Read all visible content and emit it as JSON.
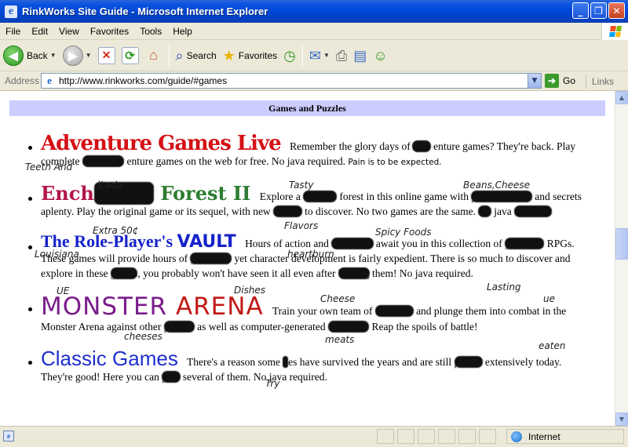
{
  "window": {
    "title": "RinkWorks Site Guide - Microsoft Internet Explorer",
    "buttons": {
      "minimize": "_",
      "maximize": "❐",
      "close": "✕"
    }
  },
  "menu": [
    "File",
    "Edit",
    "View",
    "Favorites",
    "Tools",
    "Help"
  ],
  "toolbar": {
    "back": "Back",
    "search": "Search",
    "favorites": "Favorites"
  },
  "address": {
    "label": "Address",
    "url": "http://www.rinkworks.com/guide/#games",
    "go": "Go",
    "links": "Links"
  },
  "page": {
    "section_title": "Games and Puzzles",
    "games": [
      {
        "logo": "Adventure Games Live",
        "text_a": "Remember the glory days of",
        "text_b": "enture games? They're back. Play complete",
        "text_c": "enture games on the web for free. No java required.",
        "note": "Pain is to be expected.",
        "scrawls": [
          "Teeth And"
        ]
      },
      {
        "logo_a": "Ench",
        "logo_b": "Forest II",
        "text_a": "Explore a",
        "text_b": "forest in this online game with",
        "text_c": "and secrets aplenty. Play the original game or its sequel, with new",
        "text_d": "to discover. No two games are the same.",
        "text_e": "java",
        "scrawls": [
          "iLada",
          "Tasty",
          "Beans,Cheese",
          "Flavors",
          "Extra 50¢"
        ]
      },
      {
        "logo_a": "The",
        "logo_b": "Role-Player's",
        "logo_c": "VAULT",
        "text_a": "Hours of action and",
        "text_b": "await you in this collection of",
        "text_c": "RPGs. These games will provide hours of",
        "text_d": "yet character development is fairly expedient. There is so much to discover and explore in these",
        "text_e": ", you probably won't have seen it all even after",
        "text_f": "them! No java required.",
        "scrawls": [
          "Spicy Foods",
          "Louisiana",
          "heartburn",
          "Dishes",
          "Lasting"
        ]
      },
      {
        "logo_a": "MONSTER",
        "logo_b": "ARENA",
        "text_a": "Train your own team of",
        "text_b": "and plunge them into combat in the Monster Arena against other",
        "text_c": "as well as computer-generated",
        "text_d": "Reap the spoils of battle!",
        "scrawls": [
          "UE",
          "Cheese",
          "ue",
          "cheeses",
          "meats"
        ]
      },
      {
        "logo": "Classic Games",
        "text_a": "There's a reason some",
        "text_b": "es have survived the years and are still",
        "text_c": "extensively today. They're good! Here you can",
        "text_d": "several of them. No java required.",
        "scrawls": [
          "eaten",
          "Try"
        ]
      }
    ]
  },
  "status": {
    "zone": "Internet"
  },
  "colors": {
    "titlebar": "#0a53e0",
    "chrome": "#ece9d8",
    "section_bar": "#ccccff"
  }
}
